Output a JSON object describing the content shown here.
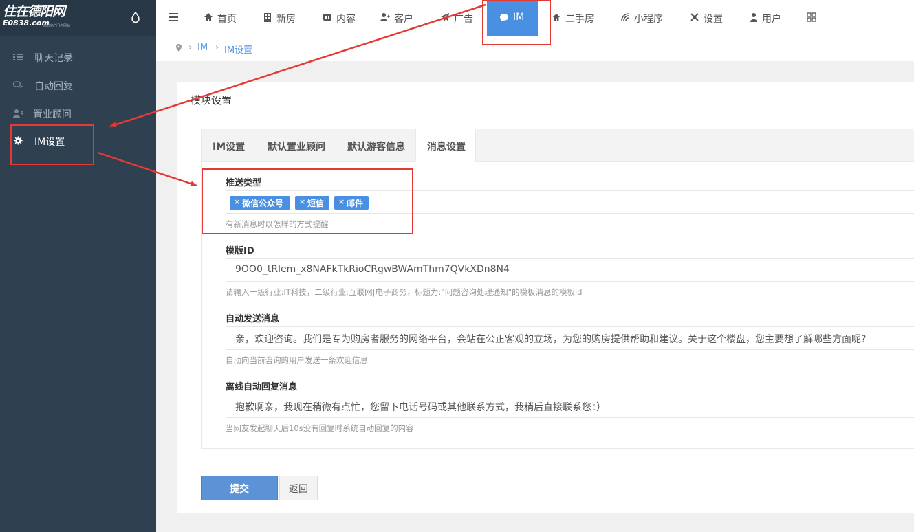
{
  "logo": {
    "main": "住在德阳网",
    "domain": "E0838.com",
    "tiny": "德阳房产门户网站"
  },
  "sidebar": {
    "items": [
      {
        "label": "聊天记录",
        "icon": "list-icon"
      },
      {
        "label": "自动回复",
        "icon": "comments-icon"
      },
      {
        "label": "置业顾问",
        "icon": "user-card-icon"
      },
      {
        "label": "IM设置",
        "icon": "gear-icon"
      }
    ]
  },
  "topnav": {
    "items": [
      {
        "label": "首页",
        "icon": "home-icon"
      },
      {
        "label": "新房",
        "icon": "building-icon"
      },
      {
        "label": "内容",
        "icon": "content-icon"
      },
      {
        "label": "客户",
        "icon": "user-plus-icon"
      },
      {
        "label": "广告",
        "icon": "send-icon"
      },
      {
        "label": "IM",
        "icon": "chat-icon"
      },
      {
        "label": "二手房",
        "icon": "home-icon"
      },
      {
        "label": "小程序",
        "icon": "wifi-icon"
      },
      {
        "label": "设置",
        "icon": "settings-icon"
      },
      {
        "label": "用户",
        "icon": "user-icon"
      }
    ]
  },
  "breadcrumb": {
    "items": [
      "IM",
      "IM设置"
    ]
  },
  "panel": {
    "title": "模块设置"
  },
  "tabs": [
    "IM设置",
    "默认置业顾问",
    "默认游客信息",
    "消息设置"
  ],
  "form": {
    "push_type": {
      "label": "推送类型",
      "tags": [
        "微信公众号",
        "短信",
        "邮件"
      ],
      "help": "有新消息时以怎样的方式提醒"
    },
    "template_id": {
      "label": "模版ID",
      "value": "9OO0_tRlem_x8NAFkTkRioCRgwBWAmThm7QVkXDn8N4",
      "help": "请输入一级行业:IT科技，二级行业:互联网|电子商务，标题为:\"问题咨询处理通知\"的模板消息的模板id"
    },
    "auto_message": {
      "label": "自动发送消息",
      "value": "亲，欢迎咨询。我们是专为购房者服务的网络平台，会站在公正客观的立场，为您的购房提供帮助和建议。关于这个楼盘，您主要想了解哪些方面呢?",
      "help": "自动向当前咨询的用户发送一条欢迎信息"
    },
    "offline_reply": {
      "label": "离线自动回复消息",
      "value": "抱歉啊亲，我现在稍微有点忙，您留下电话号码或其他联系方式，我稍后直接联系您：）",
      "help": "当网友发起聊天后10s没有回复时系统自动回复的内容"
    }
  },
  "buttons": {
    "submit": "提交",
    "back": "返回"
  },
  "colors": {
    "accent": "#4a90e2",
    "sidebar": "#2f4050",
    "annotation": "#e53935"
  }
}
